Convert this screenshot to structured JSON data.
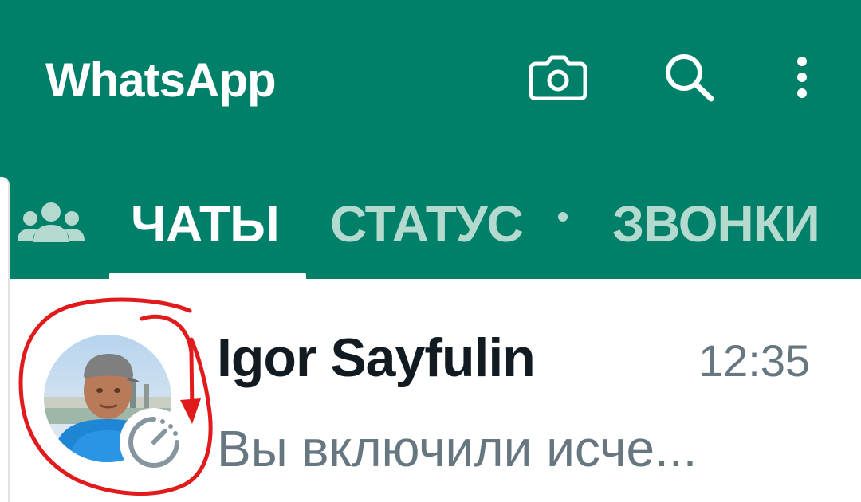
{
  "app": {
    "title": "WhatsApp",
    "accent_color": "#008069"
  },
  "header_actions": [
    {
      "name": "camera-icon"
    },
    {
      "name": "search-icon"
    },
    {
      "name": "more-vert-icon"
    }
  ],
  "tabs": {
    "communities_icon": "communities-icon",
    "items": [
      {
        "label": "ЧАТЫ",
        "active": true
      },
      {
        "label": "СТАТУС",
        "active": false,
        "has_update_dot": true
      },
      {
        "label": "ЗВОНКИ",
        "active": false
      }
    ]
  },
  "chats": [
    {
      "name": "Igor Sayfulin",
      "time": "12:35",
      "last_message": "Вы включили исче...",
      "disappearing_messages_icon": "timer-icon"
    }
  ],
  "annotation": {
    "color": "#e11b1b",
    "shape": "hand-drawn-circle-with-arrow"
  }
}
